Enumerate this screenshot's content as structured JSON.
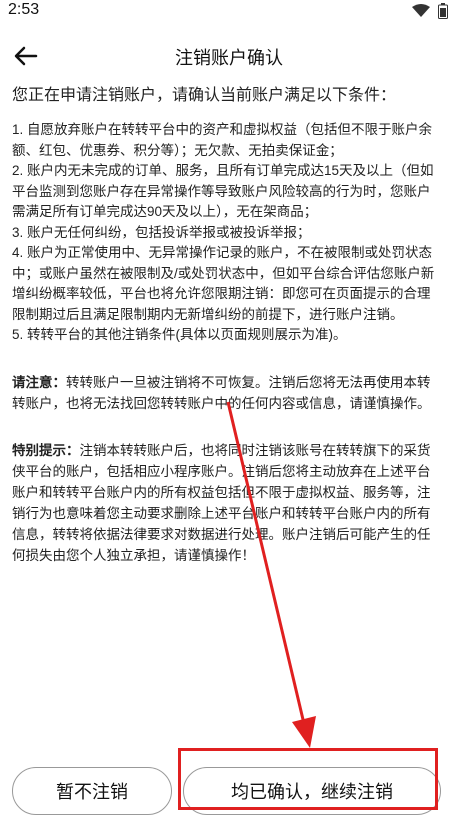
{
  "status_bar": {
    "time": "2:53"
  },
  "header": {
    "title": "注销账户确认"
  },
  "intro": "您正在申请注销账户，请确认当前账户满足以下条件：",
  "conditions": [
    "1. 自愿放弃账户在转转平台中的资产和虚拟权益（包括但不限于账户余额、红包、优惠券、积分等）；无欠款、无拍卖保证金；",
    "2. 账户内无未完成的订单、服务，且所有订单完成达15天及以上（但如平台监测到您账户存在异常操作等导致账户风险较高的行为时，您账户需满足所有订单完成达90天及以上），无在架商品；",
    "3. 账户无任何纠纷，包括投诉举报或被投诉举报；",
    "4. 账户为正常使用中、无异常操作记录的账户，不在被限制或处罚状态中；或账户虽然在被限制及/或处罚状态中，但如平台综合评估您账户新增纠纷概率较低，平台也将允许您限期注销：即您可在页面提示的合理限制期过后且满足限制期内无新增纠纷的前提下，进行账户注销。",
    "5. 转转平台的其他注销条件(具体以页面规则展示为准)。"
  ],
  "notice": {
    "label": "请注意：",
    "text": "转转账户一旦被注销将不可恢复。注销后您将无法再使用本转转账户，也将无法找回您转转账户中的任何内容或信息，请谨慎操作。"
  },
  "tip": {
    "label": "特别提示：",
    "text": "注销本转转账户后，也将同时注销该账号在转转旗下的采货侠平台的账户，包括相应小程序账户。注销后您将主动放弃在上述平台账户和转转平台账户内的所有权益包括但不限于虚拟权益、服务等，注销行为也意味着您主动要求删除上述平台账户和转转平台账户内的所有信息，转转将依据法律要求对数据进行处理。账户注销后可能产生的任何损失由您个人独立承担，请谨慎操作！"
  },
  "buttons": {
    "cancel": "暂不注销",
    "confirm": "均已确认，继续注销"
  },
  "colors": {
    "annotation": "#e02020"
  }
}
